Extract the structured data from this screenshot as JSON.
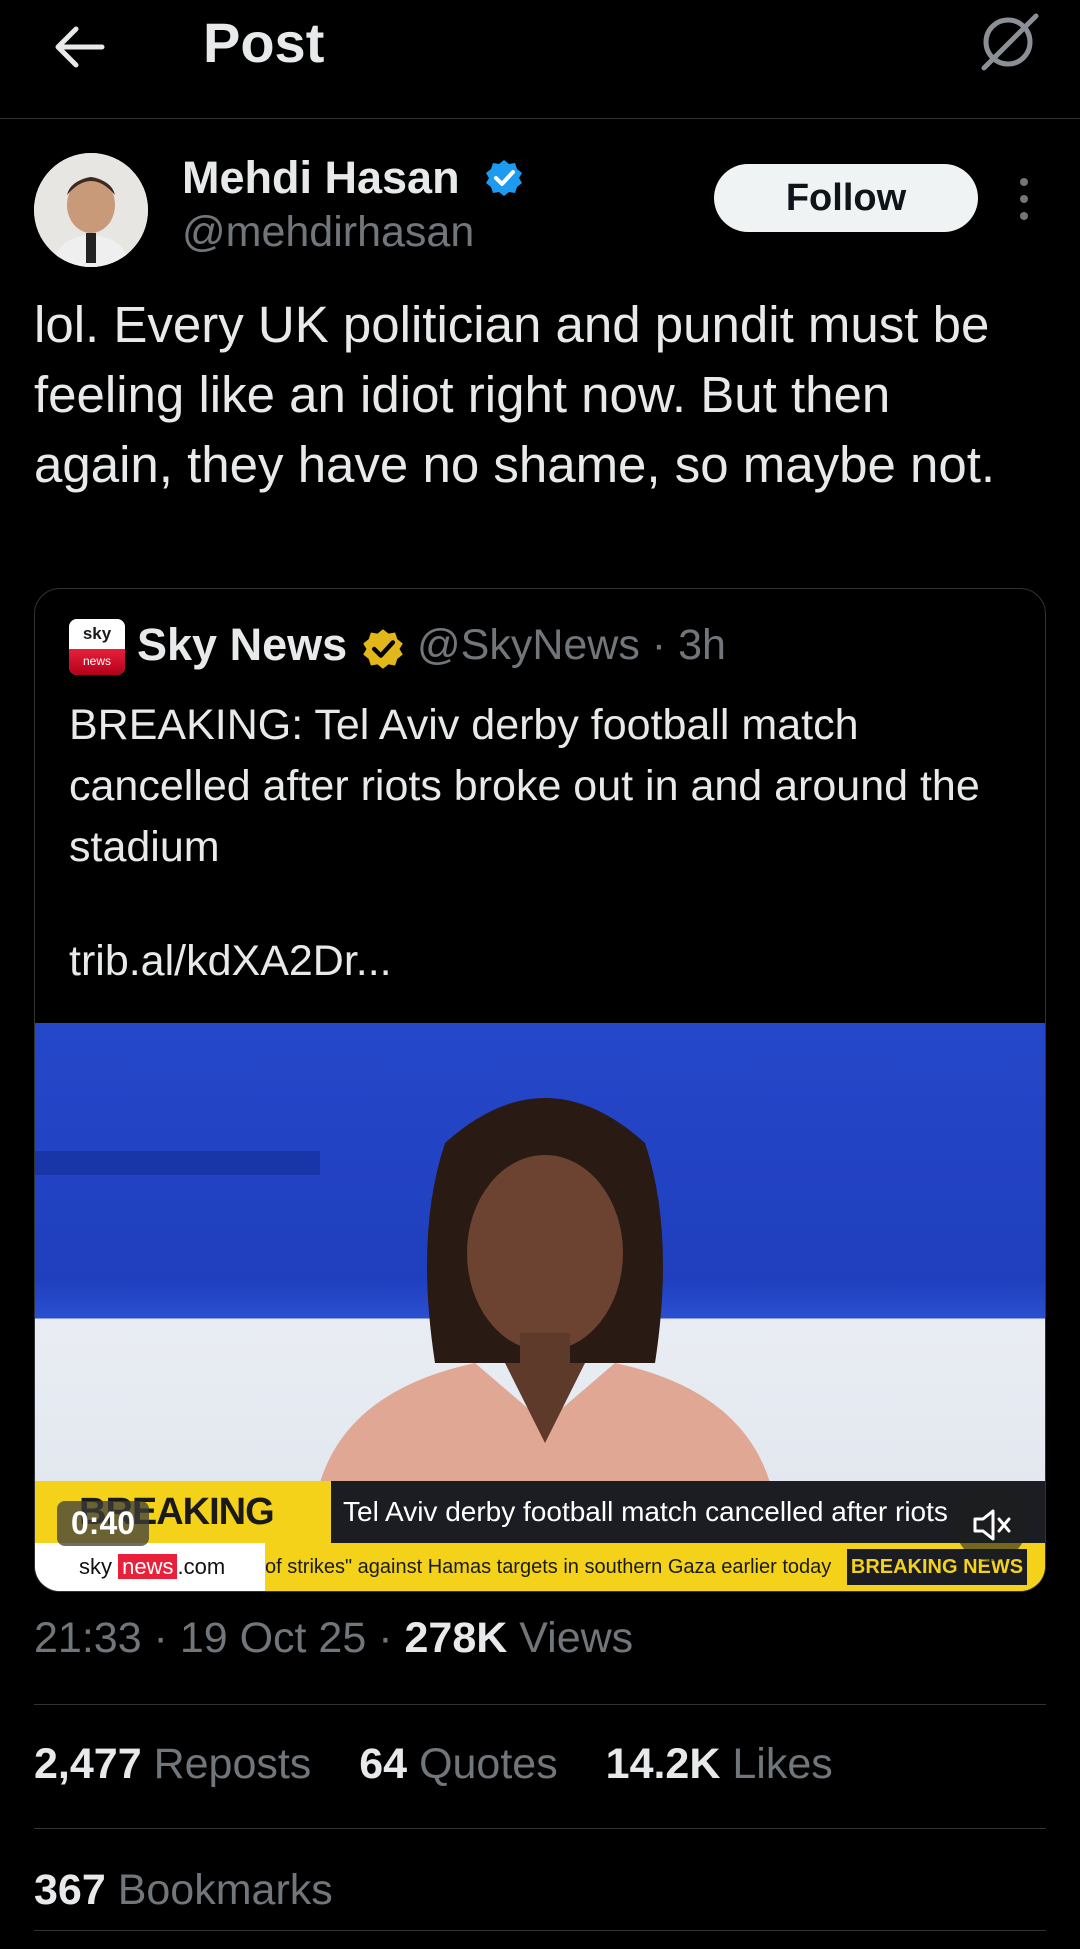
{
  "header": {
    "title": "Post",
    "back_icon": "arrow-left-icon",
    "grok_icon": "grok-icon"
  },
  "post": {
    "author": {
      "name": "Mehdi Hasan",
      "handle": "@mehdirhasan",
      "verified_color": "#1d9bf0"
    },
    "follow_label": "Follow",
    "text": "lol. Every UK politician and pundit must be feeling like an idiot right now. But then again, they have no shame, so maybe not.",
    "quoted": {
      "name": "Sky News",
      "handle_time": "@SkyNews · 3h",
      "logo_top": "sky",
      "logo_bottom": "news",
      "badge_color": "#e2b719",
      "text": "BREAKING: Tel Aviv derby football match cancelled after riots broke out in and around the stadium",
      "link": "trib.al/kdXA2Dr...",
      "video": {
        "duration": "0:40",
        "lower_third": "BREAKING NEWS",
        "headline": "Tel Aviv derby football match cancelled after riots",
        "site_pre": "sky",
        "site_news": "news",
        "site_post": ".com",
        "scroll_text": "of strikes\" against Hamas targets in southern Gaza earlier today",
        "badge2": "BREAKING NEWS"
      }
    },
    "timestamp": "21:33 · 19 Oct 25 · ",
    "views_count": "278K",
    "views_label": "Views",
    "stats": {
      "reposts_n": "2,477",
      "reposts_l": "Reposts",
      "quotes_n": "64",
      "quotes_l": "Quotes",
      "likes_n": "14.2K",
      "likes_l": "Likes",
      "bookmarks_n": "367",
      "bookmarks_l": "Bookmarks"
    }
  }
}
